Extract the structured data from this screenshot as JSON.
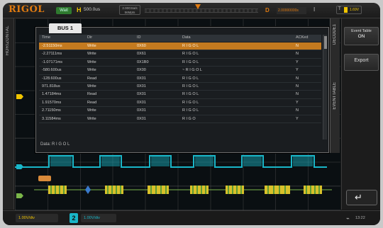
{
  "colors": {
    "accent": "#e07a10",
    "ch1": "#f0c400",
    "ch2": "#19b6c8",
    "bus": "#7ab54a",
    "selected_row": "#c47a1f"
  },
  "topbar": {
    "logo": "RIGOL",
    "run_state": "Wait",
    "h_label": "H",
    "timebase": "500.0us",
    "acq_box_line1": "2.00GSa/s",
    "acq_box_line2": "56Mpts",
    "d_label": "D",
    "sample_rate": "2.00000000s",
    "i_label": "I",
    "trigger_channel": "T",
    "trigger_value": "1.69V"
  },
  "left_menu": {
    "label": "HORIZONTAL"
  },
  "decode": {
    "bus_tab": "BUS 1",
    "columns": [
      "Time",
      "Dir",
      "ID",
      "Data",
      "ACKed"
    ],
    "rows": [
      {
        "time": "-2.51150ms",
        "dir": "Write",
        "id": "0X60",
        "data": "R I G O L",
        "ack": "N",
        "selected": true
      },
      {
        "time": "-2.27111ms",
        "dir": "Write",
        "id": "0X61",
        "data": "R I G O L",
        "ack": "N",
        "selected": false
      },
      {
        "time": "-1.07171ms",
        "dir": "Write",
        "id": "0X1B0",
        "data": "R I G O L",
        "ack": "Y",
        "selected": false
      },
      {
        "time": "-580.600us",
        "dir": "Write",
        "id": "0X00",
        "data": "~ R I G O L",
        "ack": "Y",
        "selected": false
      },
      {
        "time": "-128.600us",
        "dir": "Read",
        "id": "0X01",
        "data": "R I G O L",
        "ack": "N",
        "selected": false
      },
      {
        "time": "971.818us",
        "dir": "Write",
        "id": "0X01",
        "data": "R I G O L",
        "ack": "N",
        "selected": false
      },
      {
        "time": "1.47184ms",
        "dir": "Read",
        "id": "0X01",
        "data": "R I G O L",
        "ack": "N",
        "selected": false
      },
      {
        "time": "1.91570ms",
        "dir": "Read",
        "id": "0X01",
        "data": "R I G O L",
        "ack": "Y",
        "selected": false
      },
      {
        "time": "2.71150ms",
        "dir": "Write",
        "id": "0X01",
        "data": "R I G O L",
        "ack": "N",
        "selected": false
      },
      {
        "time": "3.11584ms",
        "dir": "Write",
        "id": "0X01",
        "data": "R I G O",
        "ack": "Y",
        "selected": false
      }
    ],
    "data_line": "Data: R I G O L",
    "side_tabs": [
      "DECODE1",
      "EVENTTABLE"
    ]
  },
  "right_menu": {
    "event_table_label": "Event Table",
    "event_table_value": "ON",
    "export_label": "Export",
    "return_icon": "return-arrow-icon"
  },
  "bottombar": {
    "ch1_scale": "1.00V/div",
    "ch2_number": "2",
    "ch2_scale": "1.00V/div",
    "usb_icon": "usb-icon",
    "clock": "13:22"
  }
}
